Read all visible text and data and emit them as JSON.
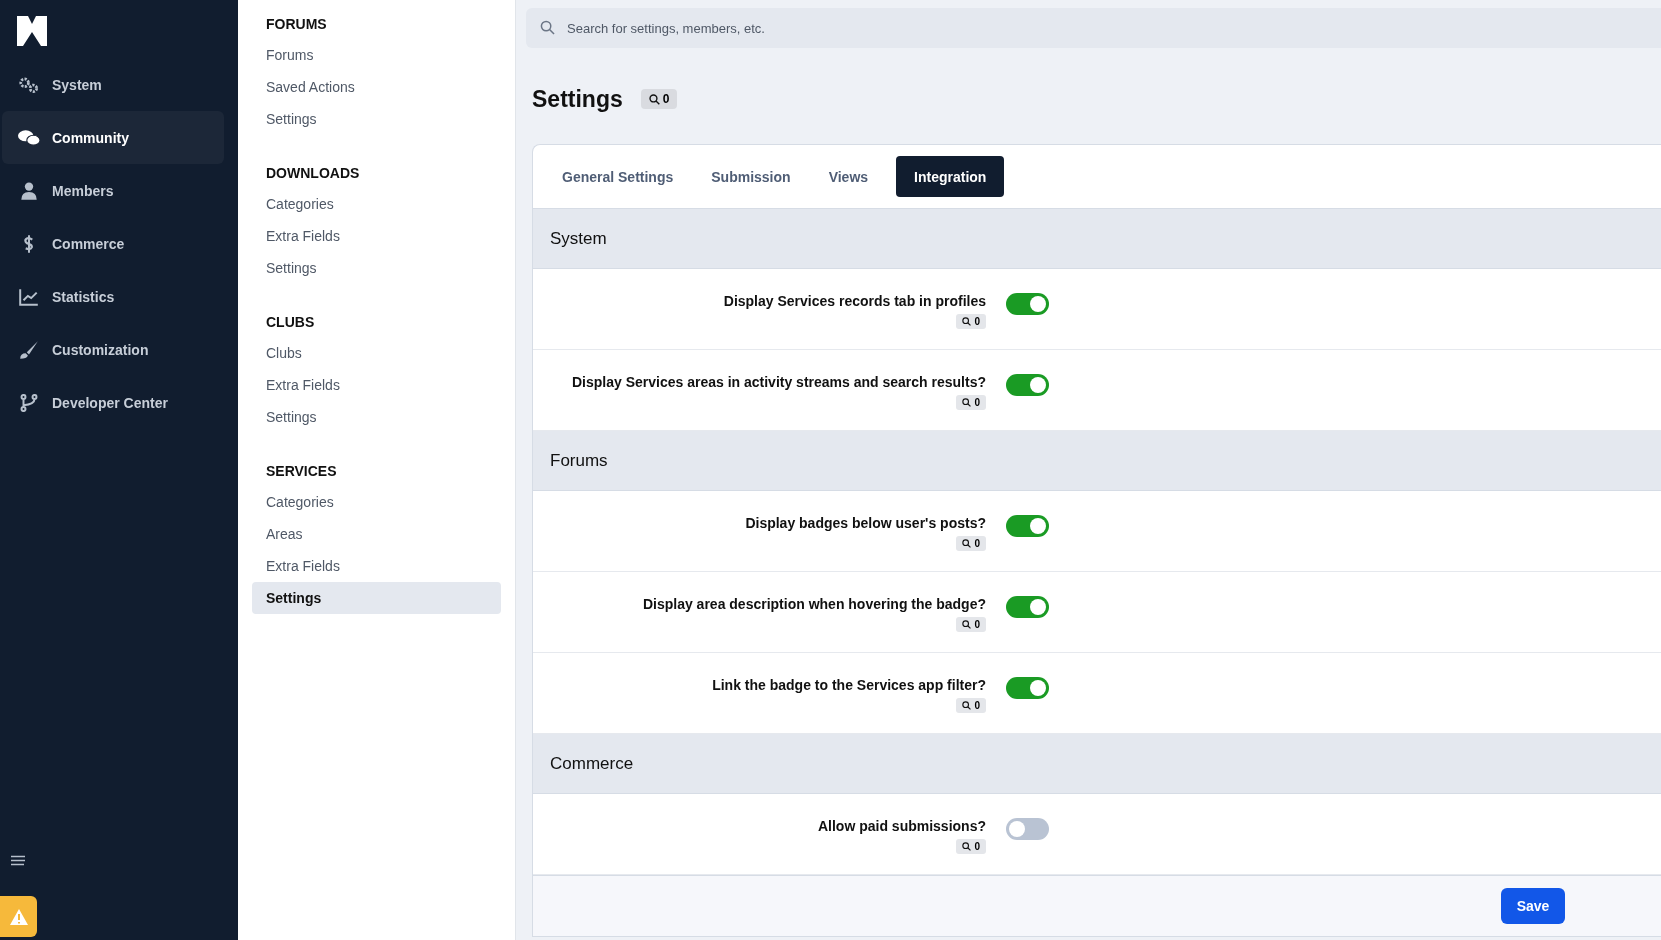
{
  "sidebar": {
    "items": [
      {
        "label": "System",
        "kind": "gears",
        "selected": false
      },
      {
        "label": "Community",
        "kind": "chat",
        "selected": true
      },
      {
        "label": "Members",
        "kind": "user",
        "selected": false
      },
      {
        "label": "Commerce",
        "kind": "dollar",
        "selected": false
      },
      {
        "label": "Statistics",
        "kind": "chart",
        "selected": false
      },
      {
        "label": "Customization",
        "kind": "brush",
        "selected": false
      },
      {
        "label": "Developer Center",
        "kind": "branch",
        "selected": false
      }
    ]
  },
  "subnav": {
    "groups": [
      {
        "heading": "FORUMS",
        "items": [
          {
            "label": "Forums",
            "selected": false
          },
          {
            "label": "Saved Actions",
            "selected": false
          },
          {
            "label": "Settings",
            "selected": false
          }
        ]
      },
      {
        "heading": "DOWNLOADS",
        "items": [
          {
            "label": "Categories",
            "selected": false
          },
          {
            "label": "Extra Fields",
            "selected": false
          },
          {
            "label": "Settings",
            "selected": false
          }
        ]
      },
      {
        "heading": "CLUBS",
        "items": [
          {
            "label": "Clubs",
            "selected": false
          },
          {
            "label": "Extra Fields",
            "selected": false
          },
          {
            "label": "Settings",
            "selected": false
          }
        ]
      },
      {
        "heading": "SERVICES",
        "items": [
          {
            "label": "Categories",
            "selected": false
          },
          {
            "label": "Areas",
            "selected": false
          },
          {
            "label": "Extra Fields",
            "selected": false
          },
          {
            "label": "Settings",
            "selected": true
          }
        ]
      }
    ]
  },
  "search": {
    "placeholder": "Search for settings, members, etc."
  },
  "page": {
    "title": "Settings",
    "count": "0"
  },
  "tabs": [
    {
      "label": "General Settings",
      "selected": false
    },
    {
      "label": "Submission",
      "selected": false
    },
    {
      "label": "Views",
      "selected": false
    },
    {
      "label": "Integration",
      "selected": true
    }
  ],
  "sections": [
    {
      "title": "System",
      "settings": [
        {
          "label": "Display Services records tab in profiles",
          "count": "0",
          "on": true
        },
        {
          "label": "Display Services areas in activity streams and search results?",
          "count": "0",
          "on": true
        }
      ]
    },
    {
      "title": "Forums",
      "settings": [
        {
          "label": "Display badges below user's posts?",
          "count": "0",
          "on": true
        },
        {
          "label": "Display area description when hovering the badge?",
          "count": "0",
          "on": true
        },
        {
          "label": "Link the badge to the Services app filter?",
          "count": "0",
          "on": true
        }
      ]
    },
    {
      "title": "Commerce",
      "settings": [
        {
          "label": "Allow paid submissions?",
          "count": "0",
          "on": false
        }
      ]
    }
  ],
  "save_button": "Save"
}
